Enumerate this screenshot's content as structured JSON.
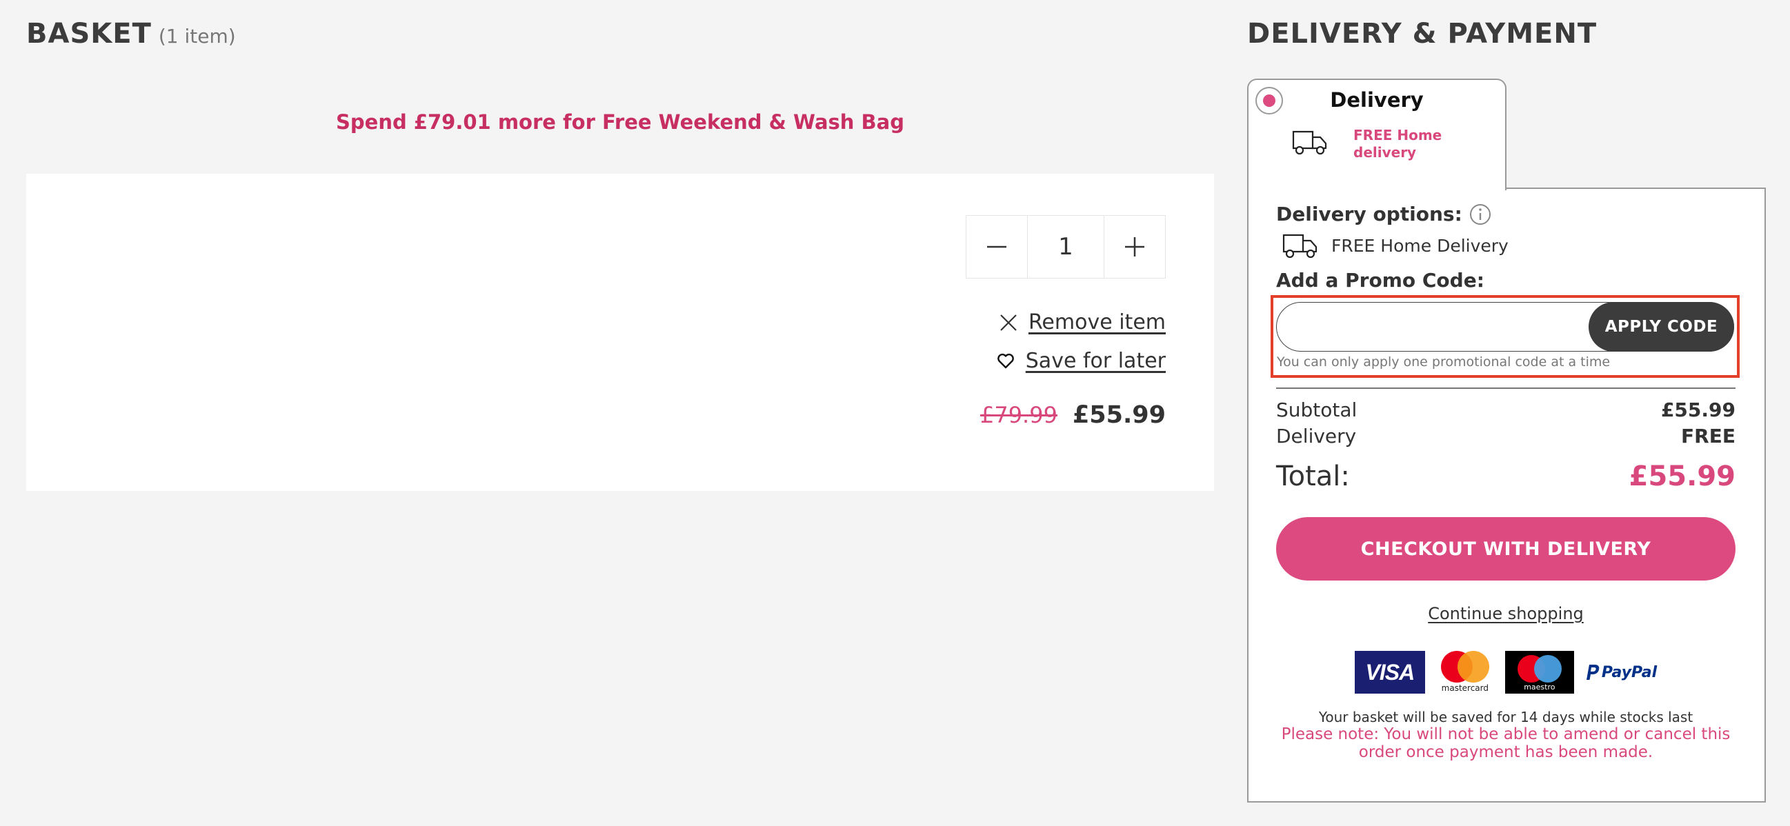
{
  "basket": {
    "title": "BASKET",
    "count": "(1 item)",
    "promo_banner": "Spend £79.01 more for Free Weekend & Wash Bag",
    "item": {
      "quantity": "1",
      "remove_label": "Remove item",
      "save_label": "Save for later",
      "old_price": "£79.99",
      "new_price": "£55.99"
    }
  },
  "delivery_payment": {
    "title": "DELIVERY & PAYMENT",
    "tab": {
      "label": "Delivery",
      "sub_label": "FREE Home delivery"
    },
    "delivery_options_label": "Delivery options:",
    "delivery_option": "FREE Home Delivery",
    "promo": {
      "label": "Add a Promo Code:",
      "value": "",
      "placeholder": "",
      "apply_label": "APPLY CODE",
      "hint": "You can only apply one promotional code at a time"
    },
    "summary": {
      "subtotal_label": "Subtotal",
      "subtotal_value": "£55.99",
      "delivery_label": "Delivery",
      "delivery_value": "FREE",
      "total_label": "Total:",
      "total_value": "£55.99"
    },
    "checkout_label": "CHECKOUT WITH DELIVERY",
    "continue_label": "Continue shopping",
    "payment_logos": {
      "visa": "VISA",
      "mastercard": "mastercard",
      "maestro": "maestro",
      "paypal": "PayPal"
    },
    "note_saved": "Your basket will be saved for 14 days while stocks last",
    "note_warning": "Please note: You will not be able to amend or cancel this order once payment has been made."
  },
  "colors": {
    "accent": "#dc4a7f",
    "banner": "#c72f63",
    "highlight_box": "#e2402b",
    "dark_button": "#3c3c3c"
  }
}
